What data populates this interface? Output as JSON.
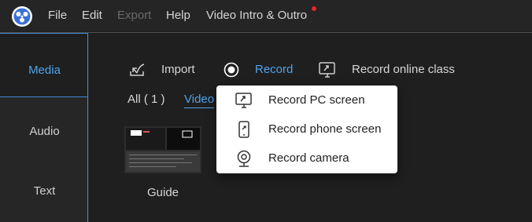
{
  "menubar": {
    "items": [
      {
        "label": "File",
        "enabled": true
      },
      {
        "label": "Edit",
        "enabled": true
      },
      {
        "label": "Export",
        "enabled": false
      },
      {
        "label": "Help",
        "enabled": true
      },
      {
        "label": "Video Intro & Outro",
        "enabled": true
      }
    ],
    "notification_color": "#e5262b"
  },
  "sidebar": {
    "tabs": [
      {
        "label": "Media",
        "active": true
      },
      {
        "label": "Audio",
        "active": false
      },
      {
        "label": "Text",
        "active": false
      }
    ]
  },
  "toolbar": {
    "import_label": "Import",
    "record_label": "Record",
    "record_online_label": "Record online class",
    "active": "record"
  },
  "filters": {
    "all_label": "All ( 1 )",
    "video_label": "Video",
    "active": "video"
  },
  "media": {
    "items": [
      {
        "label": "Guide"
      }
    ]
  },
  "record_menu": {
    "items": [
      {
        "label": "Record PC screen",
        "icon": "monitor-icon"
      },
      {
        "label": "Record phone screen",
        "icon": "phone-icon"
      },
      {
        "label": "Record camera",
        "icon": "webcam-icon"
      }
    ]
  },
  "colors": {
    "accent": "#4fa3ec",
    "background": "#1f1f1f",
    "menubar": "#252525"
  }
}
